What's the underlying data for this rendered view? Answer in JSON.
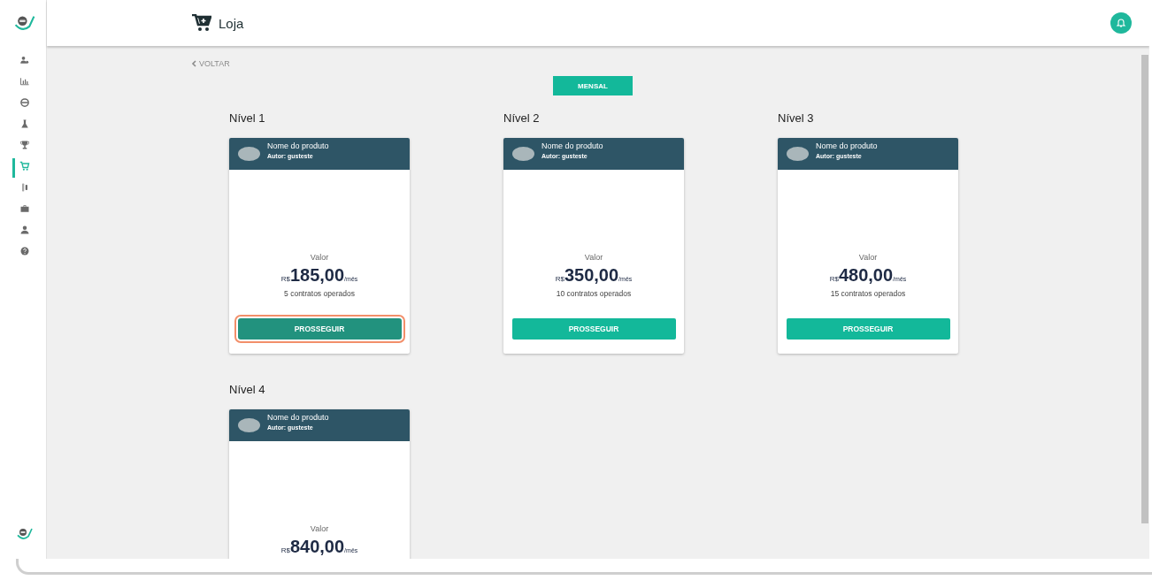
{
  "sidebar": {
    "items": [
      {
        "kind": "users",
        "selected": false
      },
      {
        "kind": "chart",
        "selected": false
      },
      {
        "kind": "ring",
        "selected": false
      },
      {
        "kind": "flask",
        "selected": false
      },
      {
        "kind": "trophy",
        "selected": false
      },
      {
        "kind": "cart",
        "selected": true
      },
      {
        "kind": "device",
        "selected": false
      },
      {
        "kind": "briefcase",
        "selected": false
      },
      {
        "kind": "person",
        "selected": false
      },
      {
        "kind": "help",
        "selected": false
      }
    ]
  },
  "header": {
    "title": "Loja"
  },
  "back_link": "VOLTAR",
  "period_button": "MENSAL",
  "levels": [
    {
      "title": "Nível 1",
      "product": "Nome do produto",
      "author": "Autor: gusteste",
      "value_label": "Valor",
      "currency": "R$",
      "price": "185,00",
      "period": "/mês",
      "contracts": "5 contratos operados",
      "button": "PROSSEGUIR",
      "focused": true
    },
    {
      "title": "Nível 2",
      "product": "Nome do produto",
      "author": "Autor: gusteste",
      "value_label": "Valor",
      "currency": "R$",
      "price": "350,00",
      "period": "/mês",
      "contracts": "10 contratos operados",
      "button": "PROSSEGUIR",
      "focused": false
    },
    {
      "title": "Nível 3",
      "product": "Nome do produto",
      "author": "Autor: gusteste",
      "value_label": "Valor",
      "currency": "R$",
      "price": "480,00",
      "period": "/mês",
      "contracts": "15 contratos operados",
      "button": "PROSSEGUIR",
      "focused": false
    },
    {
      "title": "Nível 4",
      "product": "Nome do produto",
      "author": "Autor: gusteste",
      "value_label": "Valor",
      "currency": "R$",
      "price": "840,00",
      "period": "/mês"
    }
  ]
}
